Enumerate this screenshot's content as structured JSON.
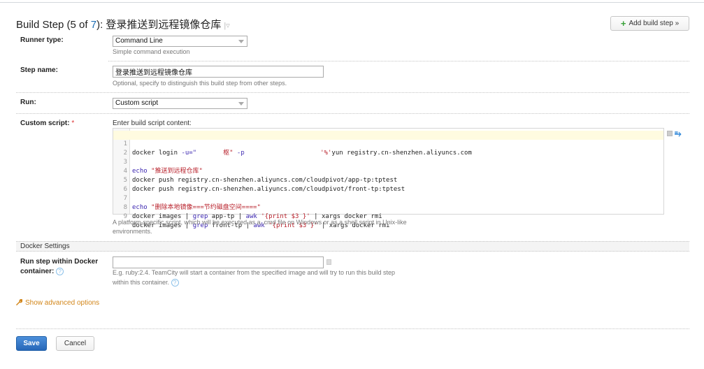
{
  "header": {
    "title_prefix": "Build Step (5 of ",
    "total_steps": "7",
    "title_suffix": "): 登录推送到远程镜像仓库",
    "menu_glyph": "|▿",
    "add_step_label": "Add build step »"
  },
  "runner_type": {
    "label": "Runner type:",
    "value": "Command Line",
    "hint": "Simple command execution"
  },
  "step_name": {
    "label": "Step name:",
    "value": "登录推送到远程镜像仓库",
    "hint": "Optional, specify to distinguish this build step from other steps."
  },
  "run": {
    "label": "Run:",
    "value": "Custom script"
  },
  "custom_script": {
    "label": "Custom script:",
    "required_mark": "*",
    "intro": "Enter build script content:",
    "lines": [
      {
        "n": "1"
      },
      {
        "n": "2"
      },
      {
        "n": "3"
      },
      {
        "n": "4"
      },
      {
        "n": "5"
      },
      {
        "n": "6"
      },
      {
        "n": "7"
      },
      {
        "n": "8"
      },
      {
        "n": "9"
      }
    ],
    "code": {
      "l1_a": "docker login ",
      "l1_b": "-u=\"",
      "l1_c": "枢\"",
      "l1_d": " -p",
      "l1_e": "'%'",
      "l1_f": "yun registry.cn-shenzhen.aliyuncs.com",
      "l3_a": "echo",
      "l3_b": " \"推送到远程仓库\"",
      "l4": "docker push registry.cn-shenzhen.aliyuncs.com/cloudpivot/app-tp:tptest",
      "l5": "docker push registry.cn-shenzhen.aliyuncs.com/cloudpivot/front-tp:tptest",
      "l7_a": "echo",
      "l7_b": " \"删除本地镜像===节约磁盘空间====\"",
      "l8_a": "docker images | ",
      "l8_b": "grep",
      "l8_c": " app-tp | ",
      "l8_d": "awk",
      "l8_e": " '{print $3 }'",
      "l8_f": " | xargs docker rmi",
      "l9_a": "docker images | ",
      "l9_b": "grep",
      "l9_c": " front-tp | ",
      "l9_d": "awk",
      "l9_e": " '{print $3 }'",
      "l9_f": " | xargs docker rmi"
    },
    "hint_line1": "A platform-specific script, which will be executed as a .cmd file on Windows or as a shell script in Unix-like",
    "hint_line2": "environments."
  },
  "docker_settings": {
    "section_title": "Docker Settings",
    "label_line1": "Run step within Docker",
    "label_line2": "container:",
    "value": "",
    "hint_line1": "E.g. ruby:2.4. TeamCity will start a container from the specified image and will try to run this build step",
    "hint_line2": "within this container.",
    "help_glyph": "?"
  },
  "advanced": {
    "label": "Show advanced options",
    "icon_glyph": "🔧"
  },
  "actions": {
    "save_label": "Save",
    "cancel_label": "Cancel"
  },
  "editor_icons": {
    "wrap_glyph": "⥱"
  }
}
